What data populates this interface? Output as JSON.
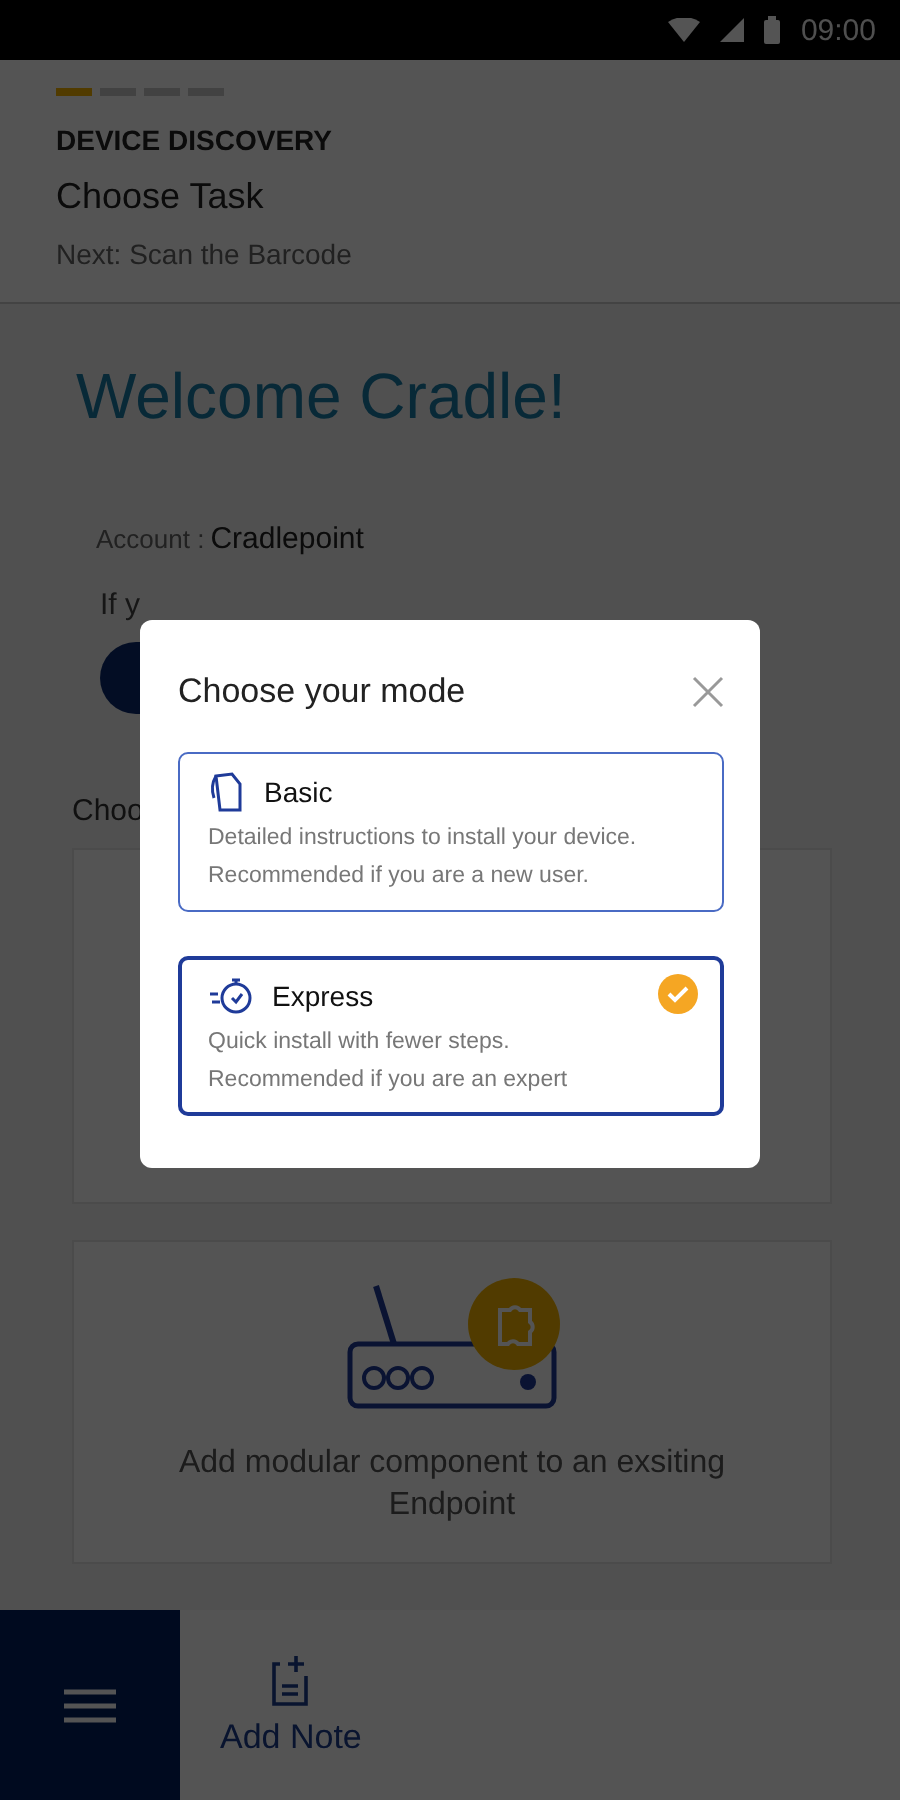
{
  "status_bar": {
    "time": "09:00"
  },
  "header": {
    "steps": [
      {
        "active": true
      },
      {
        "active": false
      },
      {
        "active": false
      },
      {
        "active": false
      }
    ],
    "section": "DEVICE DISCOVERY",
    "title": "Choose Task",
    "next": "Next: Scan the Barcode"
  },
  "content": {
    "welcome": "Welcome Cradle!",
    "account_label": "Account :",
    "account_value": "Cradlepoint",
    "info_text": "If y",
    "choose_label": "Choo",
    "cards": [
      {
        "kind": "blank"
      },
      {
        "kind": "module",
        "text": "Add modular component to an exsiting Endpoint"
      }
    ]
  },
  "bottom_bar": {
    "add_note": "Add Note"
  },
  "modal": {
    "title": "Choose your mode",
    "options": [
      {
        "kind": "basic",
        "title": "Basic",
        "lines": [
          "Detailed instructions to install your device.",
          "Recommended if you are a new user."
        ],
        "selected": false
      },
      {
        "kind": "express",
        "title": "Express",
        "lines": [
          "Quick install with fewer steps.",
          "Recommended if you are an expert"
        ],
        "selected": true
      }
    ]
  }
}
